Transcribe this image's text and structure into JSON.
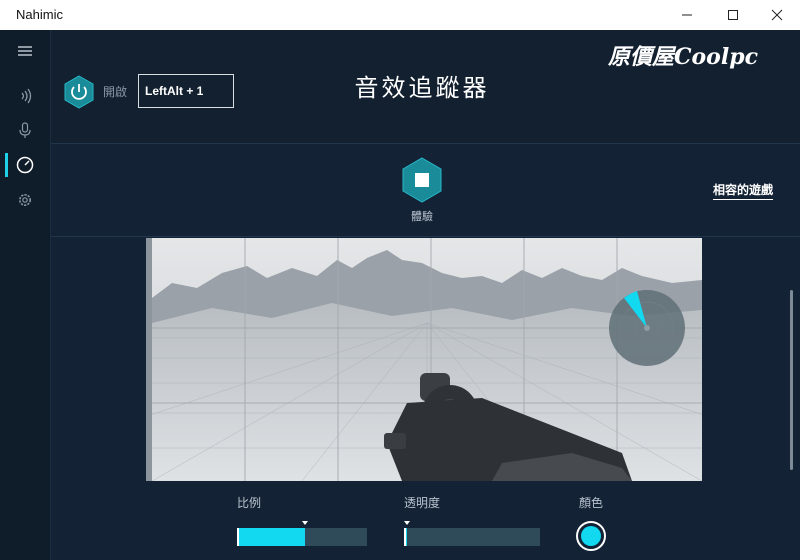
{
  "window": {
    "title": "Nahimic"
  },
  "header": {
    "power_label": "開啟",
    "hotkey": "LeftAlt + 1",
    "page_title": "音效追蹤器",
    "logo_text": "原價屋Coolpc"
  },
  "experience": {
    "label": "體驗",
    "compatible_games_link": "相容的遊戲"
  },
  "controls": {
    "scale": {
      "label": "比例",
      "value_percent": 52
    },
    "opacity": {
      "label": "透明度",
      "value_percent": 2
    },
    "color": {
      "label": "顏色",
      "value": "#12d8f0"
    }
  },
  "sidebar": {
    "items": [
      "menu-icon",
      "speaker-icon",
      "microphone-icon",
      "sound-tracker-icon",
      "settings-icon"
    ],
    "active_index": 3
  },
  "colors": {
    "accent": "#12d8f0",
    "background": "#132234"
  }
}
